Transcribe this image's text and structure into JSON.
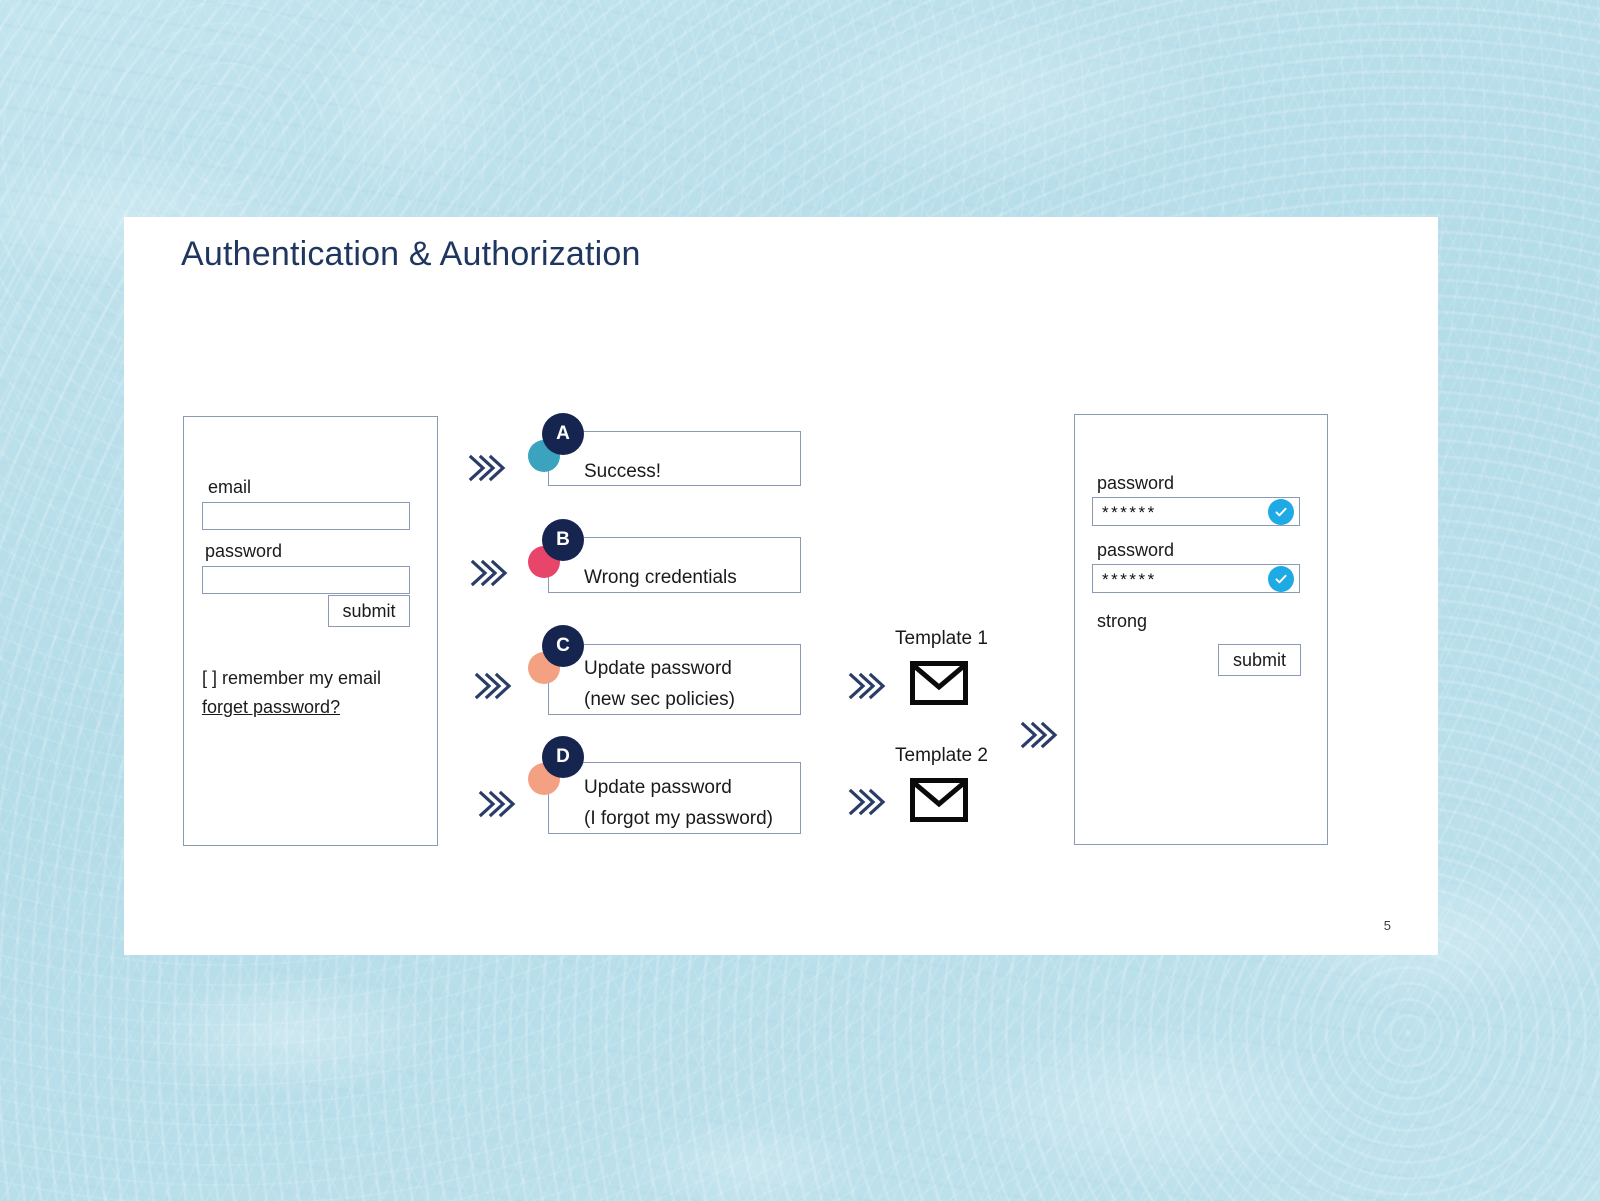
{
  "slide": {
    "title": "Authentication & Authorization",
    "page_number": "5"
  },
  "colors": {
    "background": "#b8dfea",
    "slide_bg": "#ffffff",
    "title": "#1f3760",
    "navy": "#16254f",
    "chevron": "#2a3c68",
    "border": "#8a9ab5",
    "accent_teal": "#3ba3bd",
    "accent_crimson": "#e8456a",
    "accent_salmon": "#f4a183",
    "check_blue": "#1eaae4"
  },
  "login_card": {
    "name": "login-form-card",
    "email": {
      "label": "email",
      "value": "",
      "placeholder": ""
    },
    "password": {
      "label": "password",
      "value": "",
      "placeholder": ""
    },
    "submit_label": "submit",
    "remember_label": "[  ] remember my email",
    "forgot_label": "forget password?"
  },
  "outcomes": [
    {
      "letter": "A",
      "accent": "#3ba3bd",
      "accent_name": "teal",
      "lines": [
        "Success!"
      ]
    },
    {
      "letter": "B",
      "accent": "#e8456a",
      "accent_name": "crimson",
      "lines": [
        "Wrong credentials"
      ]
    },
    {
      "letter": "C",
      "accent": "#f4a183",
      "accent_name": "salmon",
      "lines": [
        "Update password",
        "(new sec policies)"
      ]
    },
    {
      "letter": "D",
      "accent": "#f4a183",
      "accent_name": "salmon",
      "lines": [
        "Update password",
        "(I forgot my password)"
      ]
    }
  ],
  "templates": [
    {
      "label": "Template 1",
      "icon": "envelope-icon"
    },
    {
      "label": "Template 2",
      "icon": "envelope-icon"
    }
  ],
  "reset_card": {
    "name": "password-reset-card",
    "password_1": {
      "label": "password",
      "value": "******",
      "valid": true
    },
    "password_2": {
      "label": "password",
      "value": "******",
      "valid": true
    },
    "strength_label": "strong",
    "submit_label": "submit"
  }
}
